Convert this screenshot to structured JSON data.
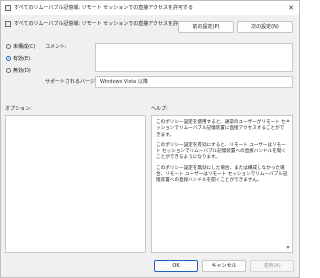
{
  "window": {
    "title": "すべてのリムーバブル記憶域: リモート セッションでの直接アクセスを許可する"
  },
  "header": {
    "setting_title": "すべてのリムーバブル記憶域: リモート セッションでの直接アクセスを許可する",
    "prev_label": "前の設定(P)",
    "next_label": "次の設定(N)"
  },
  "options": {
    "not_configured": "未構成(C)",
    "enabled": "有効(E)",
    "disabled": "無効(D)",
    "selected": "enabled"
  },
  "fields": {
    "comment_label": "コメント:",
    "comment_value": "",
    "supported_label": "サポートされるバージョン:",
    "supported_value": "Windows Vista 以降"
  },
  "sections": {
    "options_label": "オプション:",
    "help_label": "ヘルプ:"
  },
  "help": {
    "p1": "このポリシー設定を使用すると、通常のユーザーがリモート セッションでリムーバブル記憶装置に直接アクセスすることができます。",
    "p2": "このポリシー設定を有効にすると、リモート ユーザーはリモート セッションでリムーバブル記憶装置への直接ハンドルを開くことができるようになります。",
    "p3": "このポリシー設定を無効にした場合、または構成しなかった場合、リモート ユーザーはリモート セッションでリムーバブル記憶装置への直接ハンドルを開くことができません。"
  },
  "footer": {
    "ok_label": "OK",
    "cancel_label": "キャンセル",
    "apply_label": "適用(A)"
  }
}
